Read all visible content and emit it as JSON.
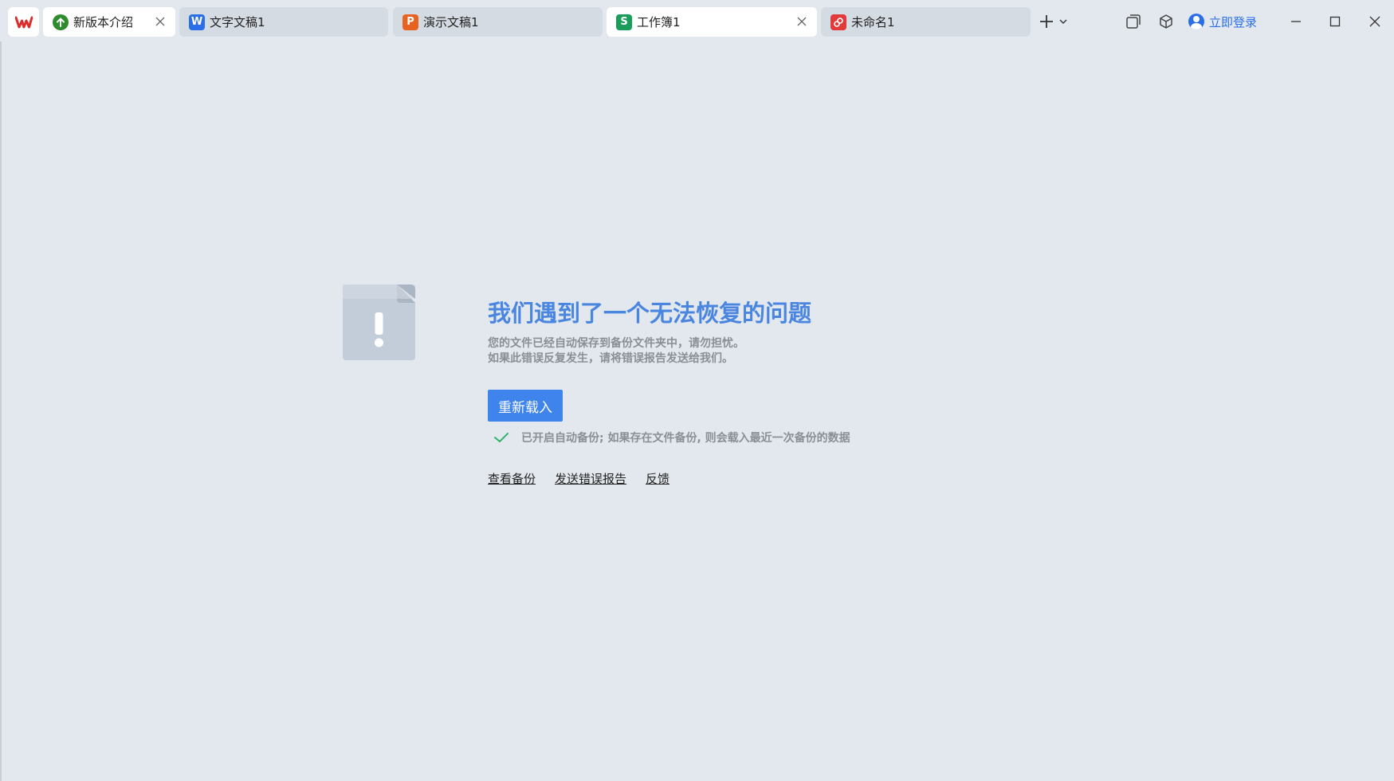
{
  "tabs": [
    {
      "label": "新版本介绍",
      "icon": "update-arrow-icon",
      "icon_color": "#2e8b2e",
      "active": true,
      "closable": true
    },
    {
      "label": "文字文稿1",
      "icon": "word-doc-icon",
      "icon_letter": "W",
      "icon_color": "#2a6ee8",
      "active": false,
      "closable": false
    },
    {
      "label": "演示文稿1",
      "icon": "presentation-icon",
      "icon_letter": "P",
      "icon_color": "#e8631f",
      "active": false,
      "closable": false
    },
    {
      "label": "工作簿1",
      "icon": "spreadsheet-icon",
      "icon_letter": "S",
      "icon_color": "#1a9c5a",
      "active": true,
      "closable": true
    },
    {
      "label": "未命名1",
      "icon": "pdf-icon",
      "icon_color": "#e03a3a",
      "active": false,
      "closable": false
    }
  ],
  "toolbar": {
    "new_tab_icon": "plus-icon",
    "login_label": "立即登录"
  },
  "error": {
    "title": "我们遇到了一个无法恢复的问题",
    "desc_line1": "您的文件已经自动保存到备份文件夹中，请勿担忧。",
    "desc_line2": "如果此错误反复发生，请将错误报告发送给我们。",
    "reload_label": "重新载入",
    "backup_note": "已开启自动备份; 如果存在文件备份, 则会载入最近一次备份的数据"
  },
  "links": {
    "view_backup": "查看备份",
    "send_report": "发送错误报告",
    "feedback": "反馈"
  },
  "colors": {
    "accent": "#3f84ec",
    "title": "#4a86e0",
    "background": "#e3e8ee"
  }
}
